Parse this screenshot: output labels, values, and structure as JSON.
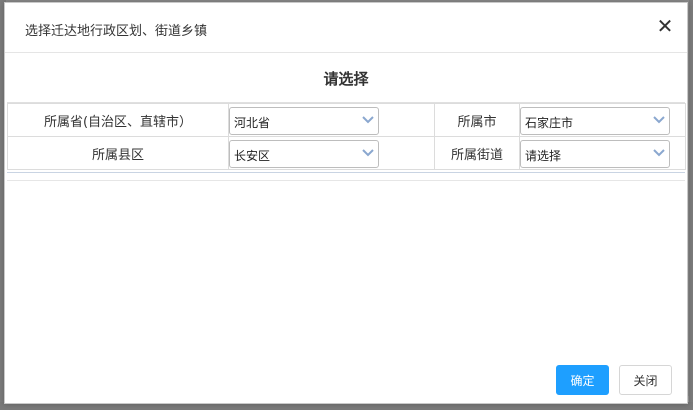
{
  "dialog": {
    "title": "选择迁达地行政区划、街道乡镇",
    "close_symbol": "✕"
  },
  "section": {
    "title": "请选择"
  },
  "form": {
    "province_label": "所属省(自治区、直辖市）",
    "province_value": "河北省",
    "city_label": "所属市",
    "city_value": "石家庄市",
    "county_label": "所属县区",
    "county_value": "长安区",
    "street_label": "所属街道",
    "street_value": "请选择"
  },
  "buttons": {
    "confirm_label": "确定",
    "close_label": "关闭"
  },
  "colors": {
    "primary_button": "#1e9fff",
    "select_arrow": "#8aa7cf"
  }
}
